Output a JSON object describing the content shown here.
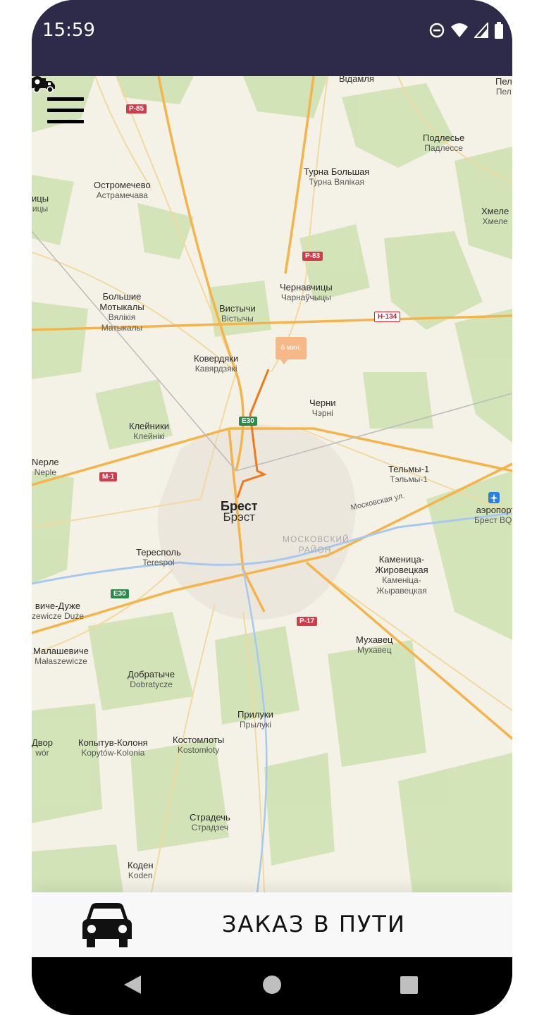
{
  "status_bar": {
    "time": "15:59"
  },
  "map": {
    "eta": "6 мин.",
    "places": [
      {
        "name": "Вiдамля",
        "sub": ""
      },
      {
        "name": "Пел",
        "sub": "Пел"
      },
      {
        "name": "Подлесье",
        "sub": "Падлессе"
      },
      {
        "name": "Турна Большая",
        "sub": "Турна Вялікая"
      },
      {
        "name": "Остромечево",
        "sub": "Астрамечава"
      },
      {
        "name": "ицы",
        "sub": "ицы"
      },
      {
        "name": "Хмеле",
        "sub": "Хмеле"
      },
      {
        "name": "Чернавчицы",
        "sub": "Чарнаўчыцы"
      },
      {
        "name": "Большие Мотыкалы",
        "sub": "Вялікія Матыкалы"
      },
      {
        "name": "Вистычи",
        "sub": "Вістычы"
      },
      {
        "name": "Ковердяки",
        "sub": "Кавярдзякі"
      },
      {
        "name": "Черни",
        "sub": "Чэрні"
      },
      {
        "name": "Клейники",
        "sub": "Клейнікі"
      },
      {
        "name": "Nepле",
        "sub": "Neple"
      },
      {
        "name": "Тельмы-1",
        "sub": "Тэльмы-1"
      },
      {
        "name": "аэропорт",
        "sub": "Брест BQT"
      },
      {
        "name": "Брест",
        "sub": "Брэст"
      },
      {
        "name": "Тересполь",
        "sub": "Terespol"
      },
      {
        "name": "Каменица-Жировецкая",
        "sub": "Каменіца-Жыравецкая"
      },
      {
        "name": "вичe-Дуже",
        "sub": "zewicze Duże"
      },
      {
        "name": "Мухавец",
        "sub": "Мухавец"
      },
      {
        "name": "Малашевичe",
        "sub": "Małaszewicze"
      },
      {
        "name": "Добратыче",
        "sub": "Dobratycze"
      },
      {
        "name": "Прилуки",
        "sub": "Прылукі"
      },
      {
        "name": "Двор",
        "sub": "wór"
      },
      {
        "name": "Копытув-Колоня",
        "sub": "Kopytów-Kolonia"
      },
      {
        "name": "Костомлоты",
        "sub": "Kostomłoty"
      },
      {
        "name": "Страдечь",
        "sub": "Страдзеч"
      },
      {
        "name": "Коден",
        "sub": "Koden"
      }
    ],
    "district": "МОСКОВСКИЙ РАЙОН",
    "street": "Московская ул.",
    "roads": [
      "Р-85",
      "Р-83",
      "Н-134",
      "Е30",
      "М-1",
      "Е30",
      "Р-17"
    ]
  },
  "bottom_bar": {
    "status": "ЗАКАЗ В ПУТИ"
  },
  "colors": {
    "status_bar": "#2d2a4a",
    "route": "#f07a1a",
    "eta_bubble": "#f6b886"
  },
  "icons": [
    "menu-icon",
    "car-icon",
    "truck-icon",
    "location-pin-icon",
    "airport-icon",
    "dnd-icon",
    "wifi-icon",
    "signal-icon",
    "battery-icon"
  ]
}
